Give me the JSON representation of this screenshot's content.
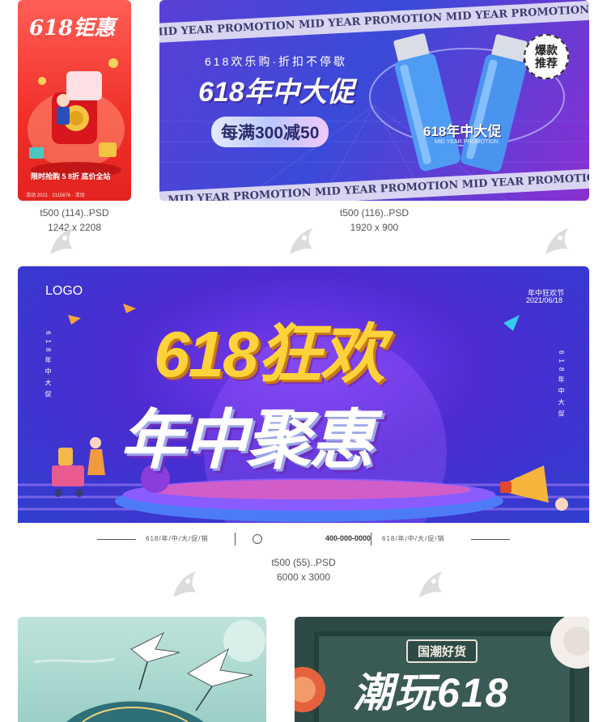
{
  "items": [
    {
      "file": "t500 (114)..PSD",
      "dims": "1242 x 2208",
      "art": {
        "headline": "618钜惠",
        "footer": "限时抢购 5 8折  底价全站",
        "tiny": "活动 2021 · 2115676 · 活动"
      }
    },
    {
      "file": "t500 (116)..PSD",
      "dims": "1920 x 900",
      "art": {
        "band_text": "MID YEAR PROMOTION  MID YEAR PROMOTION  MID YEAR PROMOTION",
        "tagline": "618欢乐购·折扣不停歇",
        "headline": "618年中大促",
        "pill": "每满300减50",
        "badge_line1": "爆款",
        "badge_line2": "推荐",
        "ring_text": "618年中大促",
        "ring_sub": "MID YEAR PROMOTION"
      }
    },
    {
      "file": "t500 (55)..PSD",
      "dims": "6000 x 3000",
      "art": {
        "logo": "LOGO",
        "corner_title": "年中狂欢节",
        "corner_date": "2021/06/18",
        "headline1": "618狂欢",
        "headline2": "年中聚惠",
        "left_vertical": "618年中大促",
        "right_vertical": "618年中大促",
        "strip_left": "618/年/中/大/促/销",
        "strip_phone": "400-000-0000",
        "strip_right": "618/年/中/大/促/销"
      }
    },
    {
      "file": "",
      "dims": "",
      "art": {}
    },
    {
      "file": "",
      "dims": "",
      "art": {
        "badge": "国潮好货",
        "headline": "潮玩618"
      }
    }
  ],
  "colors": {
    "caption": "#555555",
    "watermark": "#d6d6d6"
  }
}
